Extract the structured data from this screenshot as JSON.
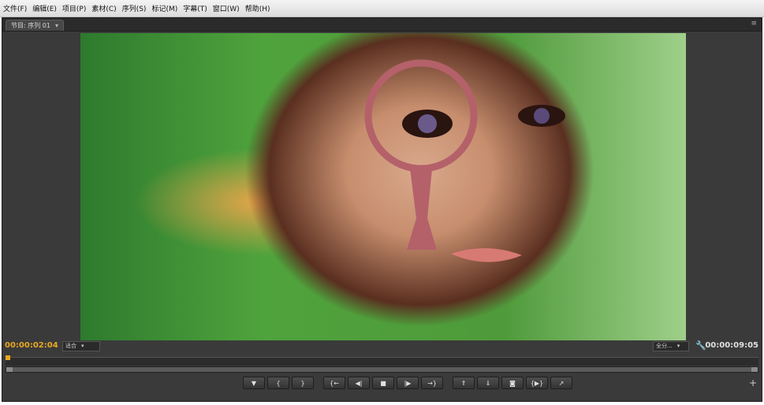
{
  "menu": {
    "items": [
      "文件(F)",
      "编辑(E)",
      "项目(P)",
      "素材(C)",
      "序列(S)",
      "标记(M)",
      "字幕(T)",
      "窗口(W)",
      "帮助(H)"
    ]
  },
  "panel": {
    "tab_label": "节目: 序列 01",
    "tab_arrow": "▾",
    "menu_glyph": "≡"
  },
  "monitor": {
    "current_time": "00:00:02:04",
    "fit_option": "适合",
    "quality_option": "全分...",
    "duration": "00:00:09:05",
    "dropdown_arrow": "▾"
  },
  "controls": {
    "buttons": [
      {
        "icon": "marker-icon",
        "glyph": "▼"
      },
      {
        "icon": "mark-in-icon",
        "glyph": "{"
      },
      {
        "icon": "mark-out-icon",
        "glyph": "}"
      },
      {
        "icon": "go-to-in-icon",
        "glyph": "{←"
      },
      {
        "icon": "step-back-icon",
        "glyph": "◀|"
      },
      {
        "icon": "stop-icon",
        "glyph": "■"
      },
      {
        "icon": "step-forward-icon",
        "glyph": "|▶"
      },
      {
        "icon": "go-to-out-icon",
        "glyph": "→}"
      },
      {
        "icon": "lift-icon",
        "glyph": "⇑"
      },
      {
        "icon": "extract-icon",
        "glyph": "⇓"
      },
      {
        "icon": "camera-icon",
        "glyph": "◙"
      },
      {
        "icon": "play-in-out-icon",
        "glyph": "{▶}"
      },
      {
        "icon": "export-icon",
        "glyph": "↗"
      }
    ],
    "add_glyph": "+"
  },
  "colors": {
    "timecode_current": "#e8a820",
    "panel_bg": "#3a3a3a",
    "magnifier": "#b4616a"
  }
}
